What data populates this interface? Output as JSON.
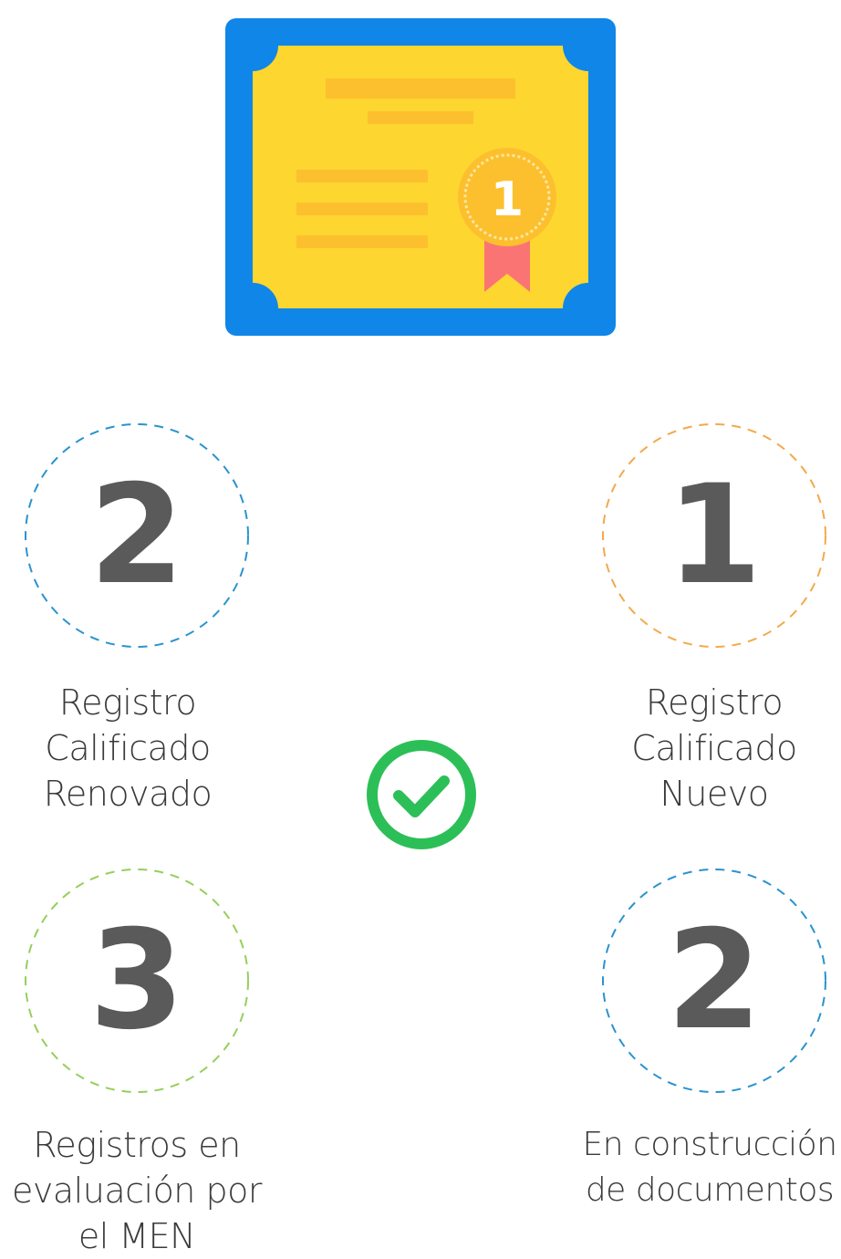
{
  "certificate": {
    "icon": "certificate-icon",
    "medal_number": "1",
    "colors": {
      "frame": "#0f86e8",
      "paper": "#fdd630",
      "lines": "#fcc02e",
      "medal": "#fcc02e",
      "ribbon": "#fb7474"
    }
  },
  "stats": [
    {
      "number": "2",
      "label_lines": [
        "Registro",
        "Calificado",
        "Renovado"
      ],
      "circle_color": "#2a93cf"
    },
    {
      "number": "1",
      "label_lines": [
        "Registro",
        "Calificado",
        "Nuevo"
      ],
      "circle_color": "#f3a94b"
    },
    {
      "number": "3",
      "label_lines": [
        "Registros en",
        "evaluación por",
        "el MEN"
      ],
      "circle_color": "#95cf5a"
    },
    {
      "number": "2",
      "label_lines": [
        "En construcción",
        "de documentos"
      ],
      "circle_color": "#2a93cf"
    }
  ],
  "center_icon": {
    "name": "check-circle-icon",
    "color": "#2dbf57"
  }
}
